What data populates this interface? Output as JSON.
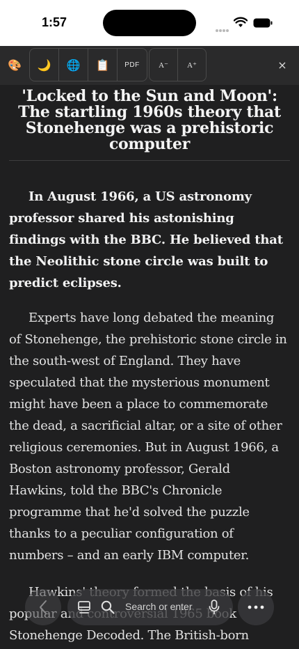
{
  "status_bar": {
    "time": "1:57"
  },
  "toolbar": {
    "palette": "🎨",
    "dark_mode": "🌙",
    "translate": "🌐",
    "clipboard": "📋",
    "pdf_label": "PDF",
    "font_smaller": "A⁻",
    "font_larger": "A⁺",
    "close": "×"
  },
  "article": {
    "headline": "'Locked to the Sun and Moon': The startling 1960s theory that Stonehenge was a prehistoric computer",
    "lead": "In August 1966, a US astronomy professor shared his astonishing findings with the BBC. He believed that the Neolithic stone circle was built to predict eclipses.",
    "paragraphs": [
      "Experts have long debated the meaning of Stonehenge, the prehistoric stone circle in the south-west of England. They have speculated that the mysterious monument might have been a place to commemorate the dead, a sacrificial altar, or a site of other religious ceremonies. But in August 1966, a Boston astronomy professor, Gerald Hawkins, told the BBC's Chronicle programme that he'd solved the puzzle thanks to a peculiar configuration of numbers – and an early IBM computer.",
      "Hawkins' theory formed the basis of his popular and controversial 1965 book Stonehenge Decoded. The British-born astronomer..."
    ]
  },
  "bottom_bar": {
    "search_placeholder": "Search or enter"
  }
}
